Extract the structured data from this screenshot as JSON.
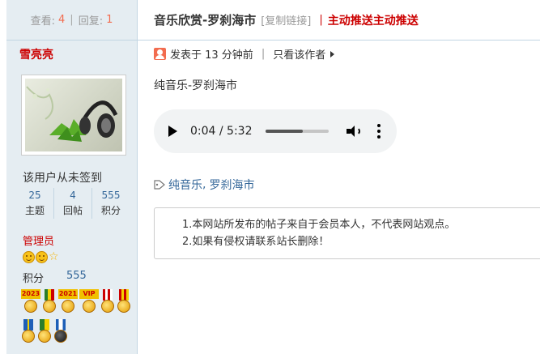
{
  "sidebar": {
    "stats": {
      "views_label": "查看:",
      "views": "4",
      "replies_label": "回复:",
      "replies": "1"
    },
    "user_name": "雪亮亮",
    "signin_status": "该用户从未签到",
    "user_stats": [
      {
        "value": "25",
        "label": "主题"
      },
      {
        "value": "4",
        "label": "回帖"
      },
      {
        "value": "555",
        "label": "积分"
      }
    ],
    "role": "管理员",
    "points_label": "积分",
    "points_value": "555",
    "medal_labels": [
      "2023",
      "2021",
      "VIP"
    ]
  },
  "header": {
    "title": "音乐欣赏-罗刹海市",
    "copy_link": "[复制链接]",
    "push_link": "主动推送主动推送"
  },
  "meta": {
    "posted": "发表于 13 分钟前",
    "only_author": "只看该作者"
  },
  "post": {
    "text": "纯音乐-罗刹海市",
    "audio": {
      "time": "0:04 / 5:32",
      "progress": 0.6
    },
    "tags": [
      "纯音乐",
      "罗刹海市"
    ],
    "notice": [
      "1.本网站所发布的帖子来自于会员本人，不代表网站观点。",
      "2.如果有侵权请联系站长删除！"
    ]
  },
  "colors": {
    "accent": "#c00000",
    "link": "#336699",
    "sidebar_bg": "#e5edf2",
    "border": "#c2d5e3"
  }
}
